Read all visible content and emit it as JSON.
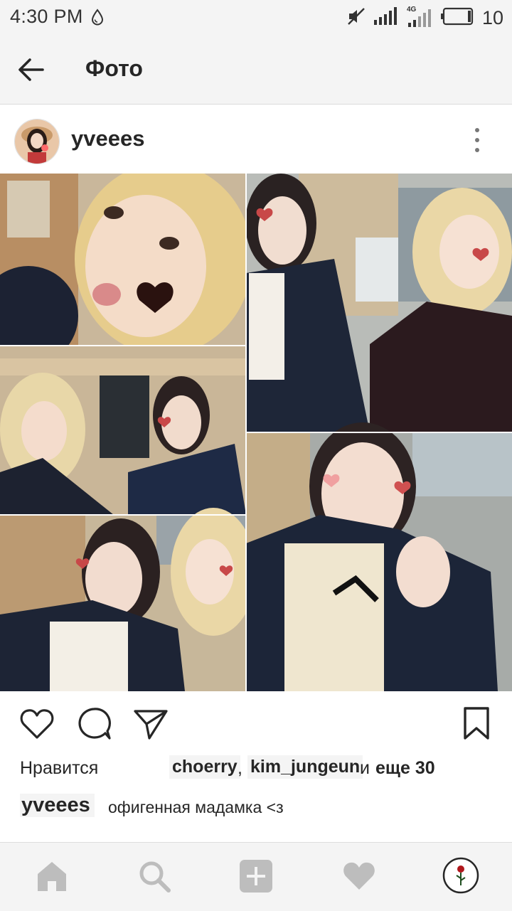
{
  "status_bar": {
    "time": "4:30 PM",
    "network_label": "4G",
    "battery_level": "10",
    "icons": [
      "water-drop-icon",
      "mute-icon",
      "signal-icon",
      "signal-4g-icon",
      "battery-icon"
    ]
  },
  "app_bar": {
    "title": "Фото",
    "back_icon": "arrow-left-icon"
  },
  "post": {
    "username": "yveees",
    "more_icon": "more-vertical-icon",
    "photo_icon": "collage-photo"
  },
  "actions": {
    "icons": [
      "heart-icon",
      "comment-icon",
      "share-icon",
      "bookmark-icon"
    ]
  },
  "likes": {
    "label": "Нравится",
    "user1": "choerry",
    "comma": ",",
    "user2": "kim_jungeun",
    "and": "и",
    "more": "еще 30"
  },
  "caption": {
    "username": "yveees",
    "text": "офигенная мадамка <з"
  },
  "bottom_nav": {
    "icons": [
      "home-icon",
      "search-icon",
      "add-icon",
      "activity-heart-icon",
      "profile-icon"
    ]
  },
  "colors": {
    "bar_background": "#f4f4f4",
    "text": "#262626",
    "nav_icon": "#bdbdbd"
  }
}
